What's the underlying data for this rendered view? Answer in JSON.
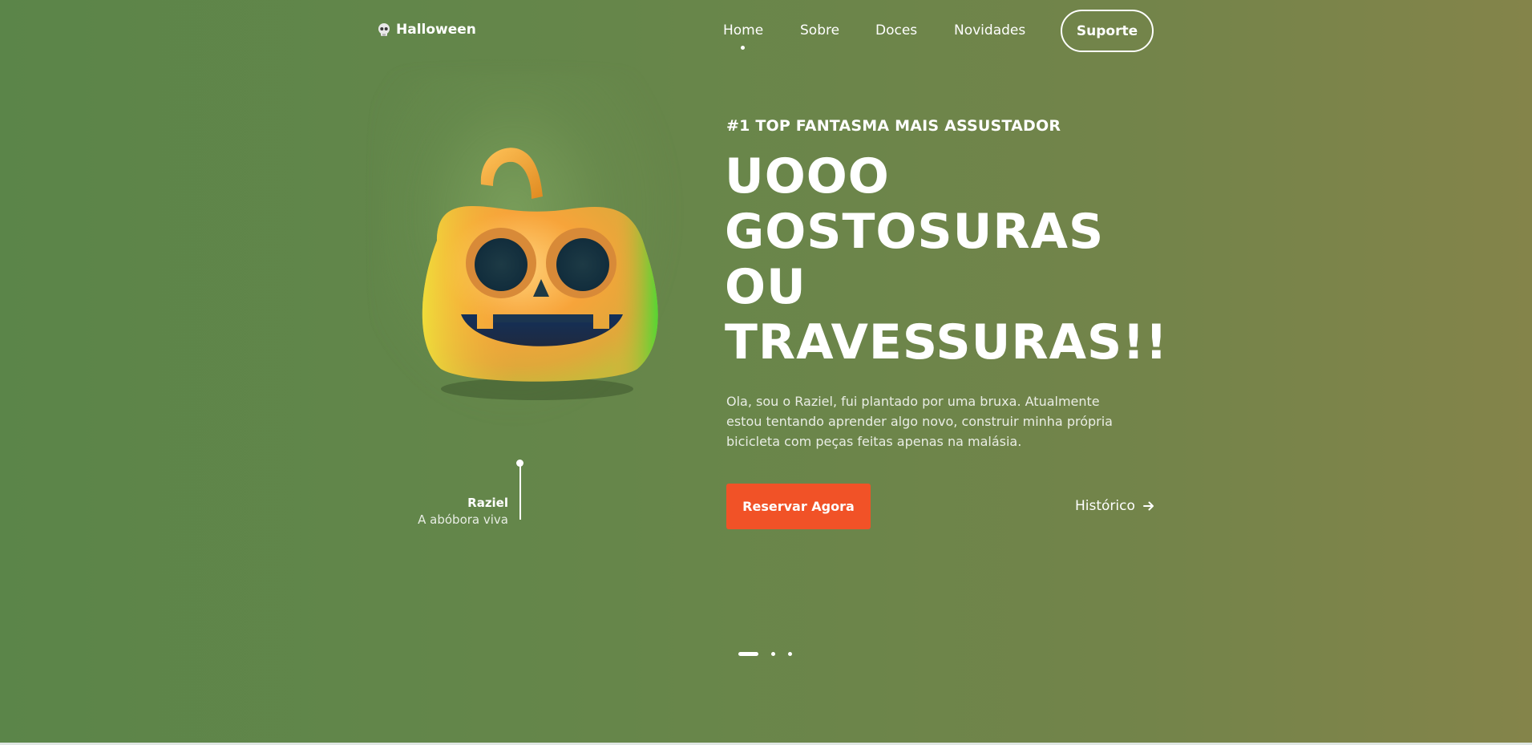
{
  "header": {
    "logo_text": "Halloween",
    "logo_icon": "skull-icon",
    "nav": [
      "Home",
      "Sobre",
      "Doces",
      "Novidades"
    ],
    "active_nav": "Home",
    "support_label": "Suporte"
  },
  "hero": {
    "eyebrow": "#1 TOP FANTASMA MAIS ASSUSTADOR",
    "headline_lines": [
      "UOOO",
      "GOSTOSURAS",
      "OU",
      "TRAVESSURAS!!"
    ],
    "description": "Ola, sou o Raziel, fui plantado por uma bruxa. Atualmente estou tentando aprender algo novo, construir minha própria bicicleta com peças feitas apenas na malásia.",
    "reserve_label": "Reservar Agora",
    "history_label": "Histórico",
    "history_icon": "arrow-right-icon"
  },
  "character": {
    "name": "Raziel",
    "subtitle": "A abóbora viva",
    "image_icon": "pumpkin-icon"
  },
  "pagination": {
    "pages": 3,
    "active_index": 0
  },
  "colors": {
    "accent": "#f15227",
    "background_start": "#5b8549",
    "background_end": "#84844a"
  }
}
